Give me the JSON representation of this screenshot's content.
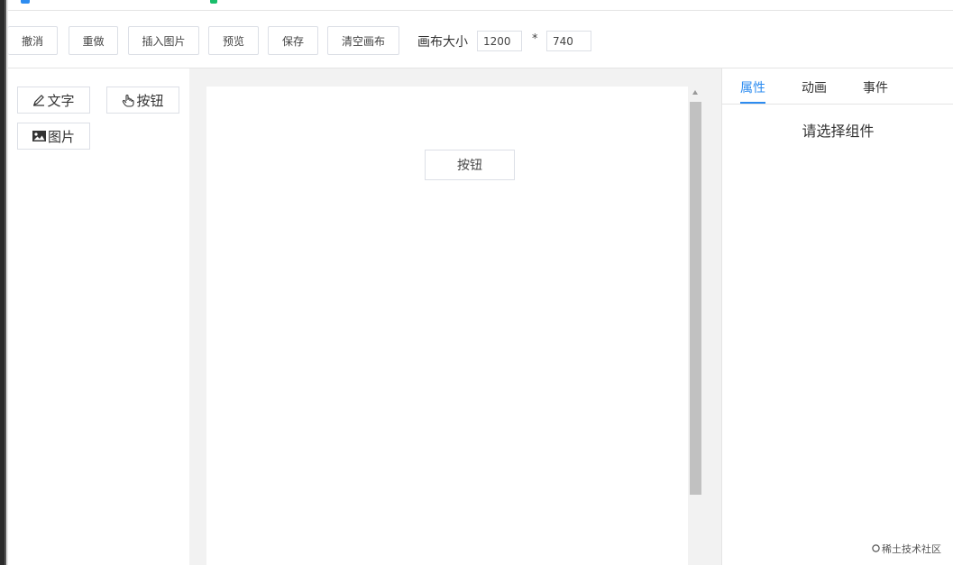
{
  "toolbar": {
    "undo_label": "撤消",
    "redo_label": "重做",
    "insert_image_label": "插入图片",
    "preview_label": "预览",
    "save_label": "保存",
    "clear_canvas_label": "清空画布",
    "canvas_size_label": "画布大小",
    "canvas_width": "1200",
    "times_sign": "*",
    "canvas_height": "740"
  },
  "components": {
    "text_label": "文字",
    "button_label": "按钮",
    "image_label": "图片",
    "icons": [
      "pencil-icon",
      "hand-pointer-icon",
      "image-icon"
    ]
  },
  "canvas": {
    "button_label": "按钮"
  },
  "right_panel": {
    "tabs": [
      {
        "label": "属性",
        "active": true
      },
      {
        "label": "动画",
        "active": false
      },
      {
        "label": "事件",
        "active": false
      }
    ],
    "empty_hint": "请选择组件"
  },
  "watermark": "稀土技术社区",
  "colors": {
    "accent": "#2d8cf0",
    "border": "#dcdfe6",
    "canvas_bg": "#f2f2f2"
  }
}
